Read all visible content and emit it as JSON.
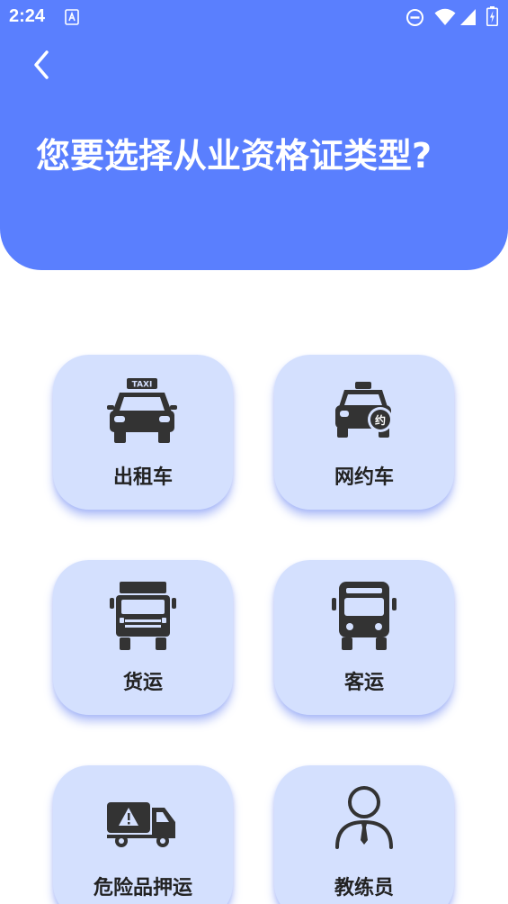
{
  "status_bar": {
    "time": "2:24"
  },
  "header": {
    "title": "您要选择从业资格证类型?"
  },
  "icon_texts": {
    "taxi_sign": "TAXI",
    "ride_hailing_badge": "约"
  },
  "certificate_types": [
    {
      "label": "出租车",
      "icon": "taxi-icon"
    },
    {
      "label": "网约车",
      "icon": "ride-hailing-car-icon"
    },
    {
      "label": "货运",
      "icon": "truck-icon"
    },
    {
      "label": "客运",
      "icon": "bus-icon"
    },
    {
      "label": "危险品押运",
      "icon": "hazmat-truck-icon"
    },
    {
      "label": "教练员",
      "icon": "instructor-icon"
    }
  ],
  "colors": {
    "header": "#5a7ffe",
    "card": "#d4e0fe",
    "icon": "#333333"
  }
}
